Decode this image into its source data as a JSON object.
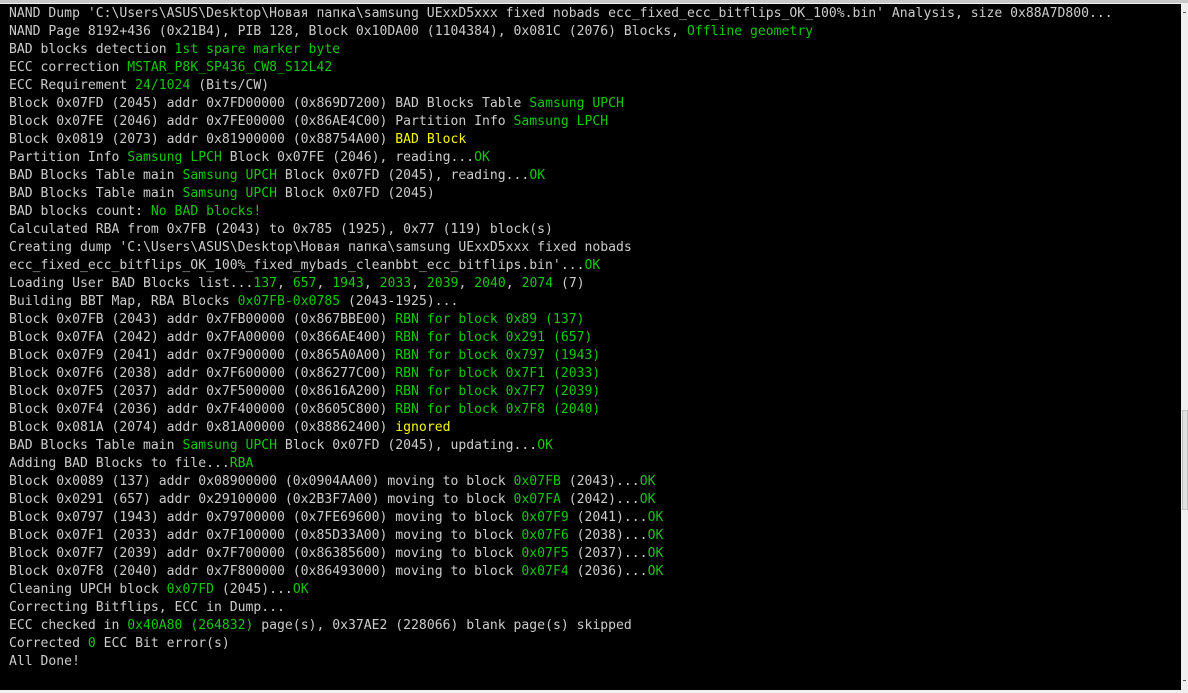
{
  "colors": {
    "default": "#cccccc",
    "green": "#16c60c",
    "yellow": "#f9f900",
    "background": "#000000"
  },
  "lines": [
    [
      [
        "NAND Dump 'C:\\Users\\ASUS\\Desktop\\Новая папка\\samsung UExxD5xxx fixed nobads ecc_fixed_ecc_bitflips_OK_100%.bin' Analysis, size 0x88A7D800...",
        ""
      ]
    ],
    [
      [
        "NAND Page 8192+436 (0x21B4), PIB 128, Block 0x10DA00 (1104384), 0x081C (2076) Blocks, ",
        ""
      ],
      [
        "Offline geometry",
        "g"
      ]
    ],
    [
      [
        "BAD blocks detection ",
        ""
      ],
      [
        "1st spare marker byte",
        "g"
      ]
    ],
    [
      [
        "ECC correction ",
        ""
      ],
      [
        "MSTAR_P8K_SP436_CW8_S12L42",
        "g"
      ]
    ],
    [
      [
        "ECC Requirement ",
        ""
      ],
      [
        "24/1024",
        "g"
      ],
      [
        " (Bits/CW)",
        ""
      ]
    ],
    [
      [
        "Block 0x07FD (2045) addr 0x7FD00000 (0x869D7200) BAD Blocks Table ",
        ""
      ],
      [
        "Samsung UPCH",
        "g"
      ]
    ],
    [
      [
        "Block 0x07FE (2046) addr 0x7FE00000 (0x86AE4C00) Partition Info ",
        ""
      ],
      [
        "Samsung LPCH",
        "g"
      ]
    ],
    [
      [
        "Block 0x0819 (2073) addr 0x81900000 (0x88754A00) ",
        ""
      ],
      [
        "BAD Block",
        "y"
      ]
    ],
    [
      [
        "Partition Info ",
        ""
      ],
      [
        "Samsung LPCH",
        "g"
      ],
      [
        " Block 0x07FE (2046), reading...",
        ""
      ],
      [
        "OK",
        "g"
      ]
    ],
    [
      [
        "BAD Blocks Table main ",
        ""
      ],
      [
        "Samsung UPCH",
        "g"
      ],
      [
        " Block 0x07FD (2045), reading...",
        ""
      ],
      [
        "OK",
        "g"
      ]
    ],
    [
      [
        "BAD Blocks Table main ",
        ""
      ],
      [
        "Samsung UPCH",
        "g"
      ],
      [
        " Block 0x07FD (2045)",
        ""
      ]
    ],
    [
      [
        "BAD blocks count: ",
        ""
      ],
      [
        "No BAD blocks!",
        "g"
      ]
    ],
    [
      [
        "Calculated RBA from 0x7FB (2043) to 0x785 (1925), 0x77 (119) block(s)",
        ""
      ]
    ],
    [
      [
        "Creating dump 'C:\\Users\\ASUS\\Desktop\\Новая папка\\samsung UExxD5xxx fixed nobads",
        ""
      ]
    ],
    [
      [
        "ecc_fixed_ecc_bitflips_OK_100%_fixed_mybads_cleanbbt_ecc_bitflips.bin'...",
        ""
      ],
      [
        "OK",
        "g"
      ]
    ],
    [
      [
        "Loading User BAD Blocks list...",
        ""
      ],
      [
        "137",
        "g"
      ],
      [
        ", ",
        ""
      ],
      [
        "657",
        "g"
      ],
      [
        ", ",
        ""
      ],
      [
        "1943",
        "g"
      ],
      [
        ", ",
        ""
      ],
      [
        "2033",
        "g"
      ],
      [
        ", ",
        ""
      ],
      [
        "2039",
        "g"
      ],
      [
        ", ",
        ""
      ],
      [
        "2040",
        "g"
      ],
      [
        ", ",
        ""
      ],
      [
        "2074",
        "g"
      ],
      [
        " (7)",
        ""
      ]
    ],
    [
      [
        "Building BBT Map, RBA Blocks ",
        ""
      ],
      [
        "0x07FB-0x0785",
        "g"
      ],
      [
        " (2043-1925)...",
        ""
      ]
    ],
    [
      [
        "Block 0x07FB (2043) addr 0x7FB00000 (0x867BBE00) ",
        ""
      ],
      [
        "RBN for block 0x89 (137)",
        "g"
      ]
    ],
    [
      [
        "Block 0x07FA (2042) addr 0x7FA00000 (0x866AE400) ",
        ""
      ],
      [
        "RBN for block 0x291 (657)",
        "g"
      ]
    ],
    [
      [
        "Block 0x07F9 (2041) addr 0x7F900000 (0x865A0A00) ",
        ""
      ],
      [
        "RBN for block 0x797 (1943)",
        "g"
      ]
    ],
    [
      [
        "Block 0x07F6 (2038) addr 0x7F600000 (0x86277C00) ",
        ""
      ],
      [
        "RBN for block 0x7F1 (2033)",
        "g"
      ]
    ],
    [
      [
        "Block 0x07F5 (2037) addr 0x7F500000 (0x8616A200) ",
        ""
      ],
      [
        "RBN for block 0x7F7 (2039)",
        "g"
      ]
    ],
    [
      [
        "Block 0x07F4 (2036) addr 0x7F400000 (0x8605C800) ",
        ""
      ],
      [
        "RBN for block 0x7F8 (2040)",
        "g"
      ]
    ],
    [
      [
        "Block 0x081A (2074) addr 0x81A00000 (0x88862400) ",
        ""
      ],
      [
        "ignored",
        "y"
      ]
    ],
    [
      [
        "BAD Blocks Table main ",
        ""
      ],
      [
        "Samsung UPCH",
        "g"
      ],
      [
        " Block 0x07FD (2045), updating...",
        ""
      ],
      [
        "OK",
        "g"
      ]
    ],
    [
      [
        "Adding BAD Blocks to file...",
        ""
      ],
      [
        "RBA",
        "g"
      ]
    ],
    [
      [
        "Block 0x0089 (137) addr 0x08900000 (0x0904AA00) moving to block ",
        ""
      ],
      [
        "0x07FB",
        "g"
      ],
      [
        " (2043)...",
        ""
      ],
      [
        "OK",
        "g"
      ]
    ],
    [
      [
        "Block 0x0291 (657) addr 0x29100000 (0x2B3F7A00) moving to block ",
        ""
      ],
      [
        "0x07FA",
        "g"
      ],
      [
        " (2042)...",
        ""
      ],
      [
        "OK",
        "g"
      ]
    ],
    [
      [
        "Block 0x0797 (1943) addr 0x79700000 (0x7FE69600) moving to block ",
        ""
      ],
      [
        "0x07F9",
        "g"
      ],
      [
        " (2041)...",
        ""
      ],
      [
        "OK",
        "g"
      ]
    ],
    [
      [
        "Block 0x07F1 (2033) addr 0x7F100000 (0x85D33A00) moving to block ",
        ""
      ],
      [
        "0x07F6",
        "g"
      ],
      [
        " (2038)...",
        ""
      ],
      [
        "OK",
        "g"
      ]
    ],
    [
      [
        "Block 0x07F7 (2039) addr 0x7F700000 (0x86385600) moving to block ",
        ""
      ],
      [
        "0x07F5",
        "g"
      ],
      [
        " (2037)...",
        ""
      ],
      [
        "OK",
        "g"
      ]
    ],
    [
      [
        "Block 0x07F8 (2040) addr 0x7F800000 (0x86493000) moving to block ",
        ""
      ],
      [
        "0x07F4",
        "g"
      ],
      [
        " (2036)...",
        ""
      ],
      [
        "OK",
        "g"
      ]
    ],
    [
      [
        "Cleaning UPCH block ",
        ""
      ],
      [
        "0x07FD",
        "g"
      ],
      [
        " (2045)...",
        ""
      ],
      [
        "OK",
        "g"
      ]
    ],
    [
      [
        "Correcting Bitflips, ECC in Dump...",
        ""
      ]
    ],
    [
      [
        "ECC checked in ",
        ""
      ],
      [
        "0x40A80 (264832)",
        "g"
      ],
      [
        " page(s), 0x37AE2 (228066) blank page(s) skipped",
        ""
      ]
    ],
    [
      [
        "Corrected ",
        ""
      ],
      [
        "0",
        "g"
      ],
      [
        " ECC Bit error(s)",
        ""
      ]
    ],
    [
      [
        "All Done!",
        ""
      ]
    ]
  ]
}
